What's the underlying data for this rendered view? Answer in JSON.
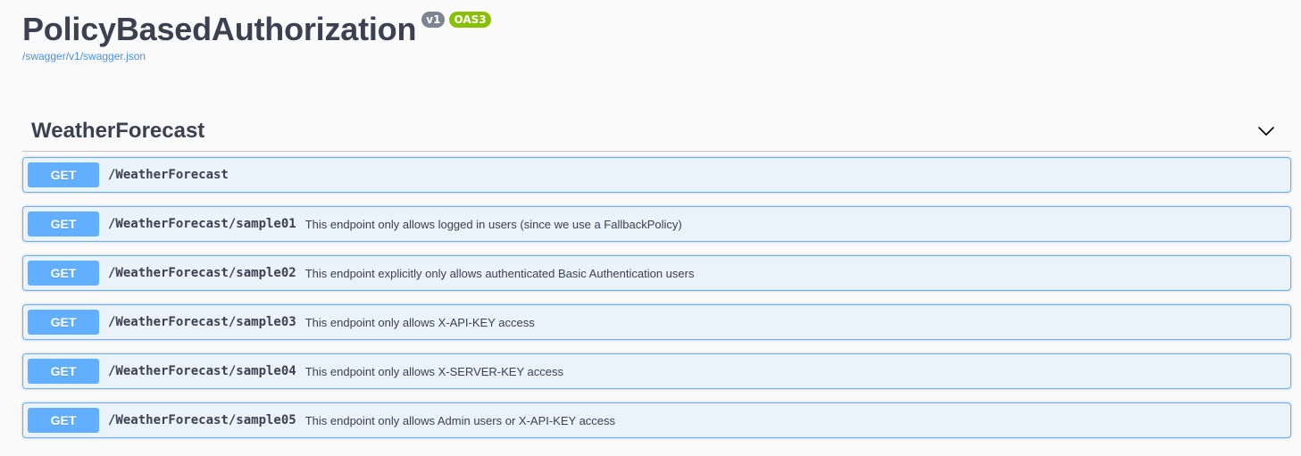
{
  "info": {
    "title": "PolicyBasedAuthorization",
    "version_badge": "v1",
    "oas_badge": "OAS3",
    "spec_link": "/swagger/v1/swagger.json"
  },
  "tag": {
    "name": "WeatherForecast",
    "chevron_icon": "chevron-down-icon"
  },
  "operations": [
    {
      "method": "GET",
      "path": "/WeatherForecast",
      "summary": ""
    },
    {
      "method": "GET",
      "path": "/WeatherForecast/sample01",
      "summary": "This endpoint only allows logged in users (since we use a FallbackPolicy)"
    },
    {
      "method": "GET",
      "path": "/WeatherForecast/sample02",
      "summary": "This endpoint explicitly only allows authenticated Basic Authentication users"
    },
    {
      "method": "GET",
      "path": "/WeatherForecast/sample03",
      "summary": "This endpoint only allows X-API-KEY access"
    },
    {
      "method": "GET",
      "path": "/WeatherForecast/sample04",
      "summary": "This endpoint only allows X-SERVER-KEY access"
    },
    {
      "method": "GET",
      "path": "/WeatherForecast/sample05",
      "summary": "This endpoint only allows Admin users or X-API-KEY access"
    }
  ],
  "colors": {
    "get_method": "#61affe",
    "text": "#3b4151",
    "link": "#4990e2",
    "badge_version": "#7d8492",
    "badge_oas": "#89bf04"
  }
}
